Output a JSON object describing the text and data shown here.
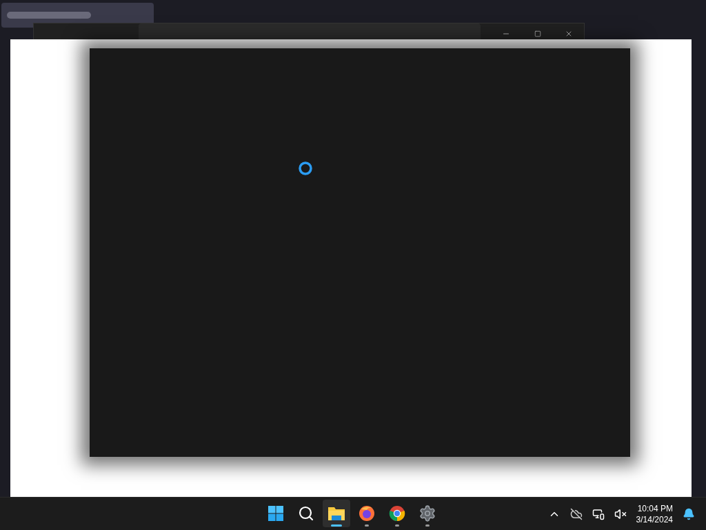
{
  "dialog": {
    "loading": true
  },
  "taskbar": {
    "apps": [
      {
        "kind": "start",
        "running": false,
        "selected": false
      },
      {
        "kind": "search",
        "running": false,
        "selected": false
      },
      {
        "kind": "folder",
        "running": true,
        "selected": true
      },
      {
        "kind": "firefox",
        "running": true,
        "selected": false
      },
      {
        "kind": "chrome",
        "running": true,
        "selected": false
      },
      {
        "kind": "settings",
        "running": true,
        "selected": false
      }
    ],
    "time": "10:04 PM",
    "date": "3/14/2024"
  }
}
